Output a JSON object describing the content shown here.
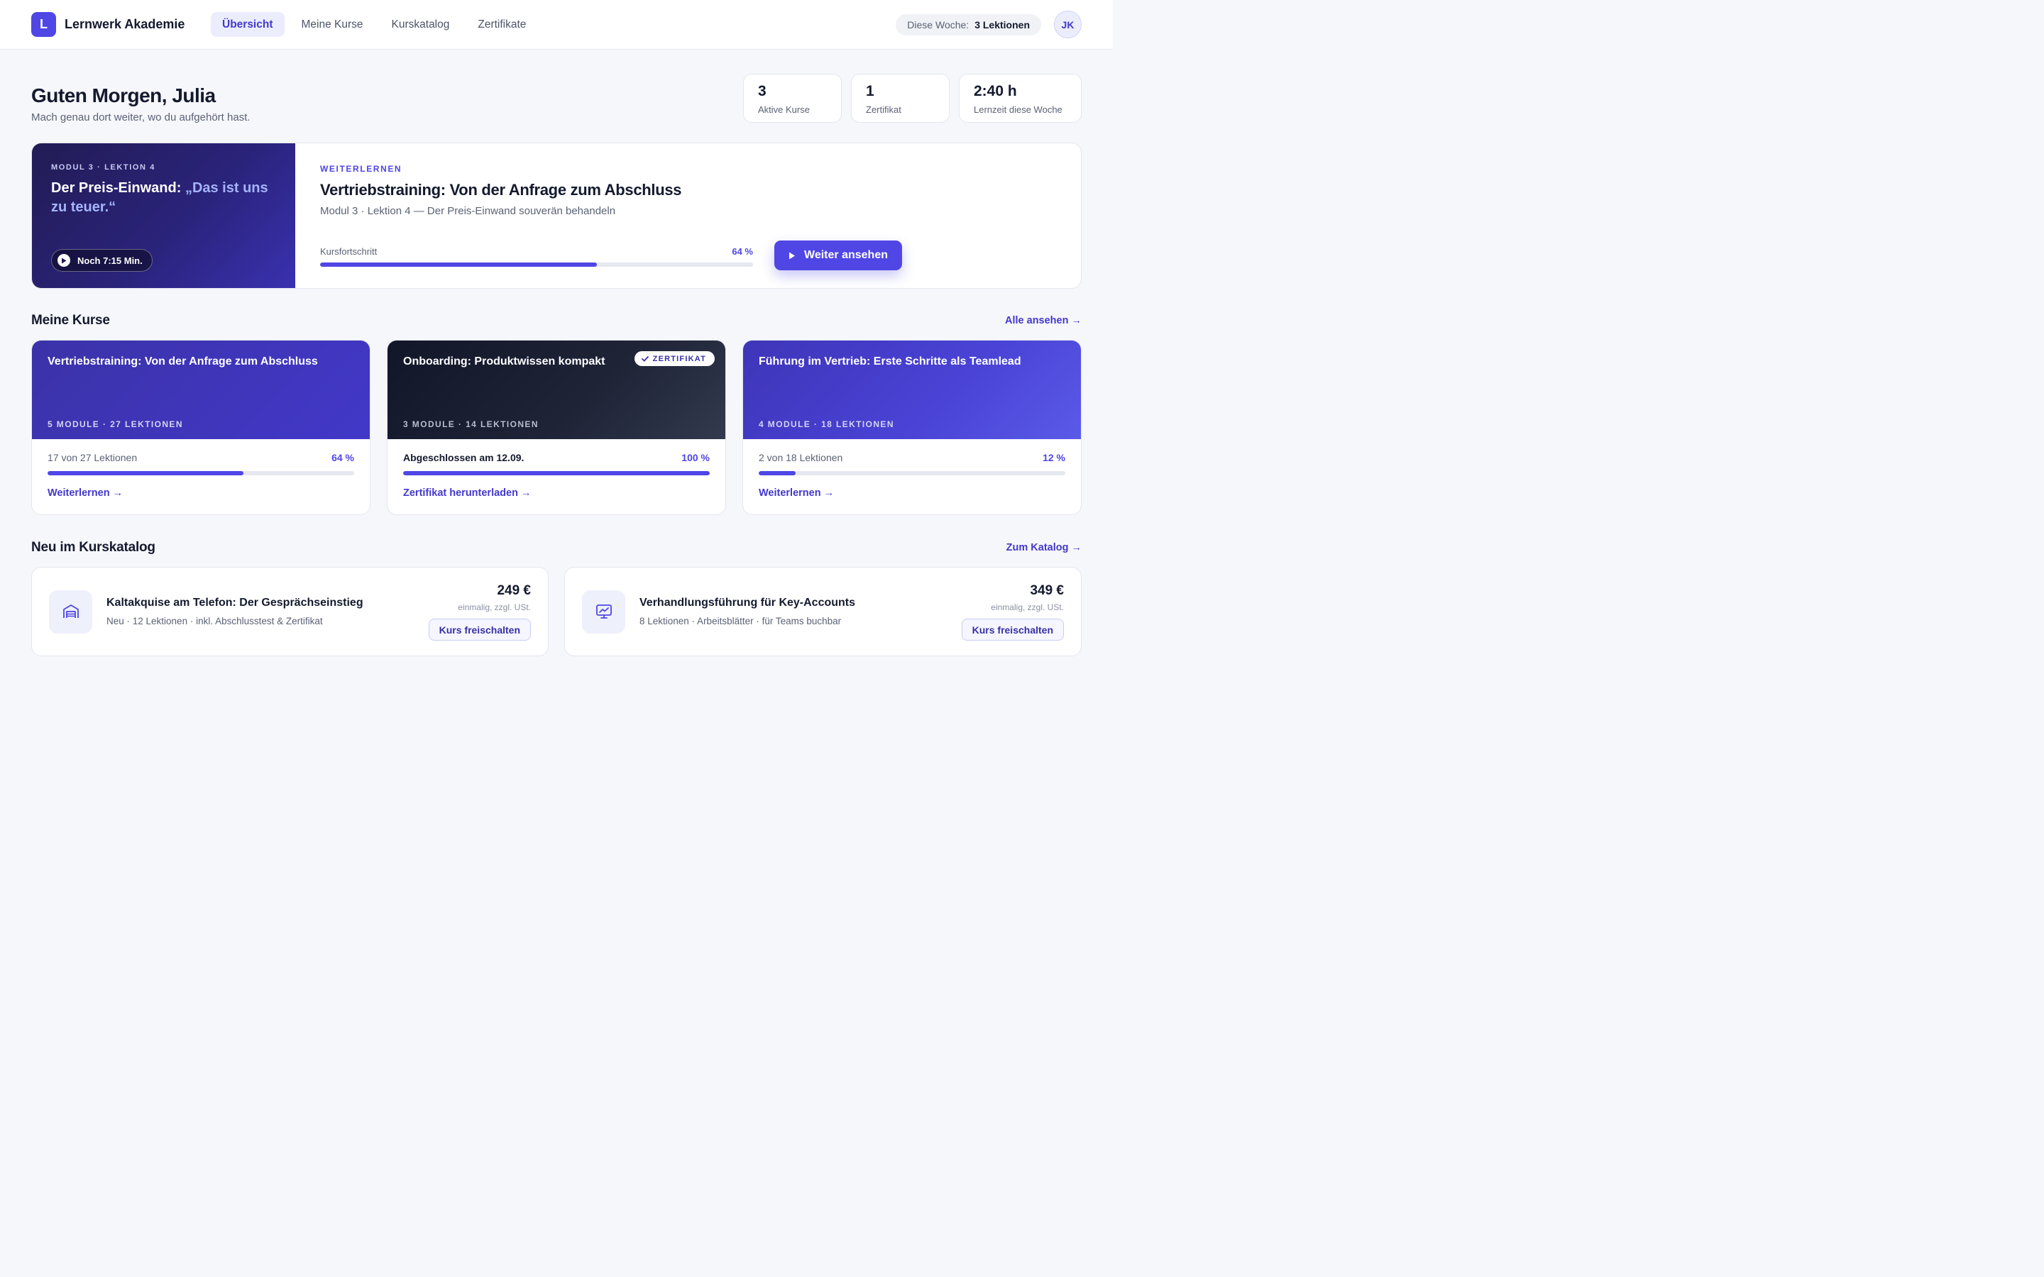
{
  "brand": {
    "logo_letter": "L",
    "name": "Lernwerk Akademie"
  },
  "nav": {
    "items": [
      {
        "label": "Übersicht",
        "active": true
      },
      {
        "label": "Meine Kurse"
      },
      {
        "label": "Kurskatalog"
      },
      {
        "label": "Zertifikate"
      }
    ]
  },
  "week": {
    "label": "Diese Woche:",
    "value": "3 Lektionen"
  },
  "user": {
    "initials": "JK"
  },
  "greeting": {
    "title": "Guten Morgen, Julia",
    "subtitle": "Mach genau dort weiter, wo du aufgehört hast."
  },
  "stats": [
    {
      "value": "3",
      "caption": "Aktive Kurse"
    },
    {
      "value": "1",
      "caption": "Zertifikat"
    },
    {
      "value": "2:40 h",
      "caption": "Lernzeit diese Woche"
    }
  ],
  "continue": {
    "thumb_eyebrow": "MODUL 3 · LEKTION 4",
    "thumb_title_a": "Der Preis-Einwand: ",
    "thumb_title_b": "„Das ist uns zu teuer.“",
    "remaining": "Noch 7:15 Min.",
    "eyebrow": "WEITERLERNEN",
    "title": "Vertriebstraining: Von der Anfrage zum Abschluss",
    "subtitle": "Modul 3 · Lektion 4 — Der Preis-Einwand souverän behandeln",
    "progress_label": "Kursfortschritt",
    "progress_text": "64 %",
    "progress": 64,
    "cta": "Weiter ansehen"
  },
  "my_courses": {
    "heading": "Meine Kurse",
    "link": "Alle ansehen →",
    "items": [
      {
        "title": "Vertriebstraining: Von der Anfrage zum Abschluss",
        "meta": "5 MODULE · 27 LEKTIONEN",
        "status": "17 von 27 Lektionen",
        "percent_text": "64 %",
        "progress": 64,
        "action": "Weiterlernen →"
      },
      {
        "title": "Onboarding: Produktwissen kompakt",
        "meta": "3 MODULE · 14 LEKTIONEN",
        "badge": "ZERTIFIKAT",
        "status": "Abgeschlossen am 12.09.",
        "percent_text": "100 %",
        "progress": 100,
        "action": "Zertifikat herunterladen →"
      },
      {
        "title": "Führung im Vertrieb: Erste Schritte als Teamlead",
        "meta": "4 MODULE · 18 LEKTIONEN",
        "status": "2 von 18 Lektionen",
        "percent_text": "12 %",
        "progress": 12,
        "action": "Weiterlernen →"
      }
    ]
  },
  "catalog": {
    "heading": "Neu im Kurskatalog",
    "link": "Zum Katalog →",
    "items": [
      {
        "icon": "warehouse-icon",
        "title": "Kaltakquise am Telefon: Der Gesprächseinstieg",
        "meta": "Neu · 12 Lektionen · inkl. Abschlusstest & Zertifikat",
        "price": "249 €",
        "note": "einmalig, zzgl. USt.",
        "button": "Kurs freischalten"
      },
      {
        "icon": "presentation-chart-icon",
        "title": "Verhandlungsführung für Key-Accounts",
        "meta": "8 Lektionen · Arbeitsblätter · für Teams buchbar",
        "price": "349 €",
        "note": "einmalig, zzgl. USt.",
        "button": "Kurs freischalten"
      }
    ]
  },
  "colors": {
    "accent": "#4f46e5",
    "accent_dark": "#4338ca",
    "background": "#f6f7fb"
  }
}
